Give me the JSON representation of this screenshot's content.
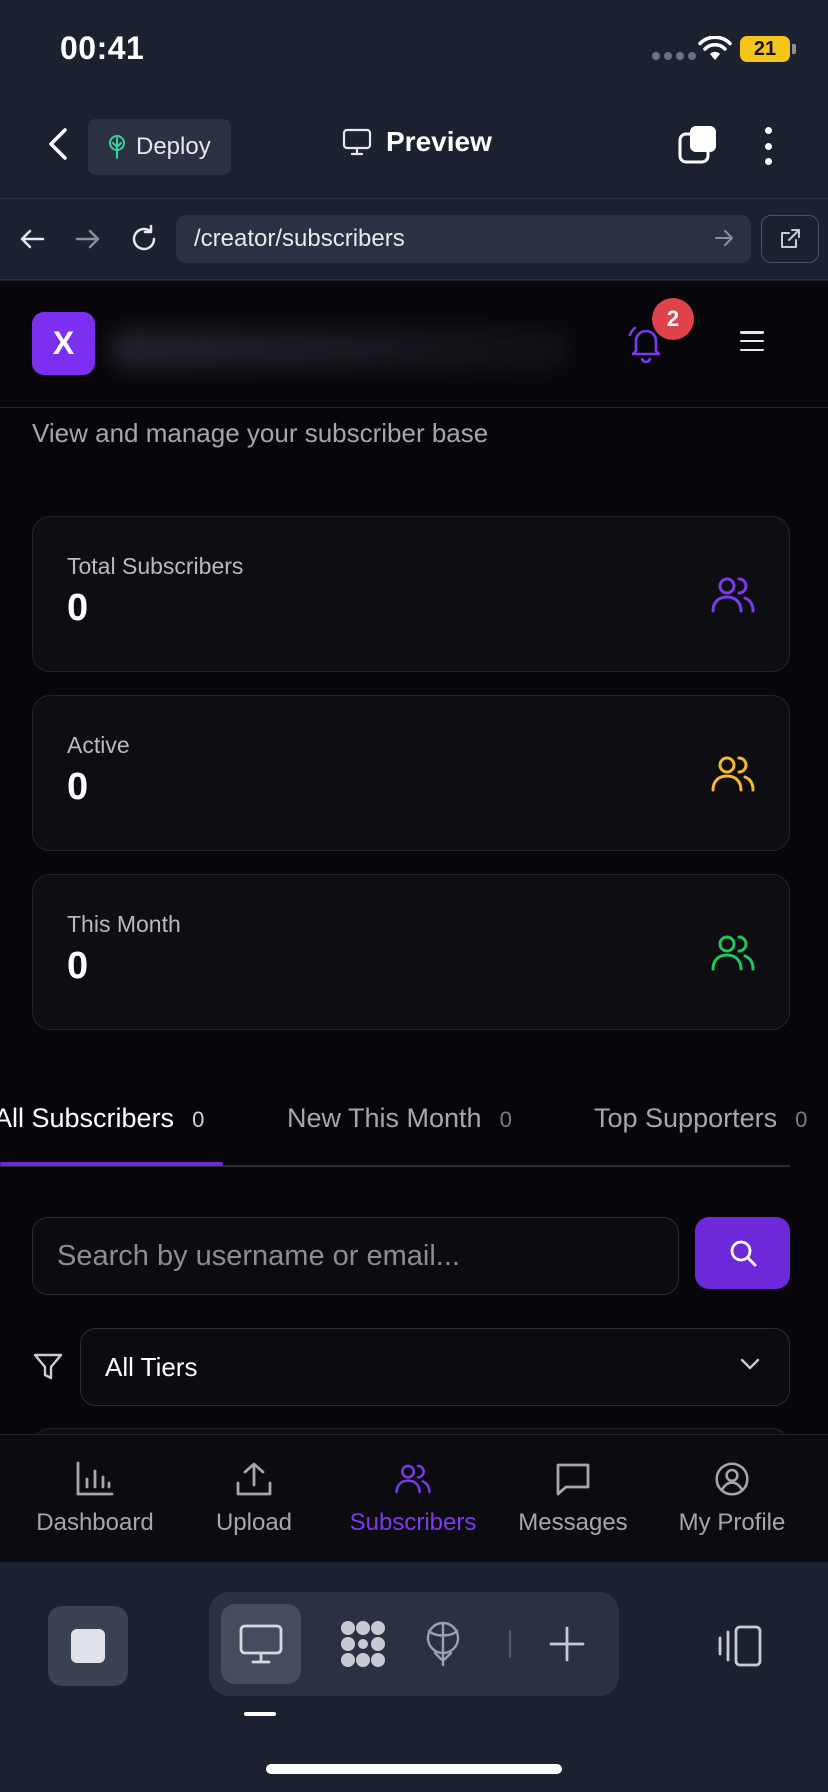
{
  "status_bar": {
    "time": "00:41",
    "battery": "21"
  },
  "app_bar": {
    "deploy_label": "Deploy",
    "preview_label": "Preview"
  },
  "browser": {
    "url": "/creator/subscribers"
  },
  "site": {
    "logo_letter": "X",
    "notification_count": "2",
    "subtitle": "View and manage your subscriber base"
  },
  "stats": [
    {
      "label": "Total Subscribers",
      "value": "0",
      "icon": "users-icon",
      "color": "#7c3aed"
    },
    {
      "label": "Active",
      "value": "0",
      "icon": "users-icon",
      "color": "#f5b82e"
    },
    {
      "label": "This Month",
      "value": "0",
      "icon": "users-icon",
      "color": "#22c55e"
    }
  ],
  "tabs": [
    {
      "label": "All Subscribers",
      "count": "0",
      "active": true
    },
    {
      "label": "New This Month",
      "count": "0",
      "active": false
    },
    {
      "label": "Top Supporters",
      "count": "0",
      "active": false
    }
  ],
  "search": {
    "placeholder": "Search by username or email..."
  },
  "filter": {
    "selected": "All Tiers"
  },
  "site_nav": [
    {
      "label": "Dashboard",
      "icon": "bar-chart-icon",
      "active": false
    },
    {
      "label": "Upload",
      "icon": "upload-icon",
      "active": false
    },
    {
      "label": "Subscribers",
      "icon": "users-icon",
      "active": true
    },
    {
      "label": "Messages",
      "icon": "message-icon",
      "active": false
    },
    {
      "label": "My Profile",
      "icon": "user-circle-icon",
      "active": false
    }
  ],
  "colors": {
    "accent": "#6d28d9",
    "badge": "#e0424a",
    "battery": "#f5c518"
  }
}
